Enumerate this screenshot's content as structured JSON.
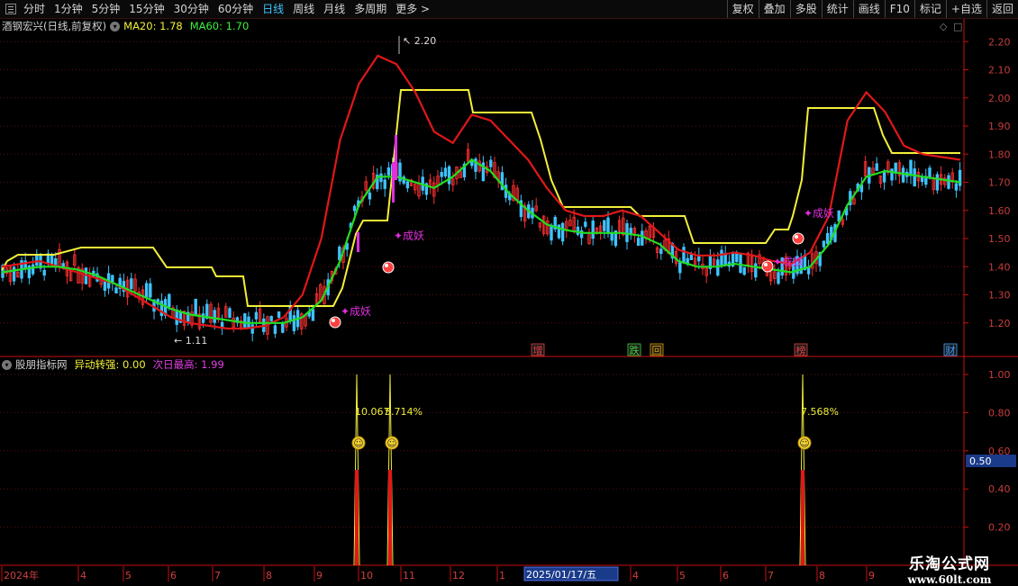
{
  "toolbar": {
    "periods": [
      "分时",
      "1分钟",
      "5分钟",
      "15分钟",
      "30分钟",
      "60分钟",
      "日线",
      "周线",
      "月线",
      "多周期",
      "更多 >"
    ],
    "active_period": "日线",
    "buttons": [
      "复权",
      "叠加",
      "多股",
      "统计",
      "画线",
      "F10",
      "标记",
      "+自选",
      "返回"
    ]
  },
  "main_chart": {
    "stock_label": "酒钢宏兴(日线,前复权)",
    "ma20_label": "MA20: 1.78",
    "ma60_label": "MA60: 1.70",
    "y_ticks": [
      "2.20",
      "2.10",
      "2.00",
      "1.90",
      "1.80",
      "1.70",
      "1.60",
      "1.50",
      "1.40",
      "1.30",
      "1.20"
    ],
    "high_label": "2.20",
    "low_label": "1.11",
    "signals": [
      "成妖",
      "成妖",
      "成妖",
      "成妖"
    ],
    "event_tags": [
      "增",
      "跌",
      "回",
      "榜",
      "财"
    ]
  },
  "indicator": {
    "name": "股朋指标网",
    "value1": "异动转强: 0.00",
    "value2": "次日最高: 1.99",
    "y_ticks": [
      "1.00",
      "0.80",
      "0.60",
      "0.40",
      "0.20"
    ],
    "current_value": "0.50",
    "pct_labels": [
      "10.067",
      "5.714%",
      "7.568%"
    ]
  },
  "time_axis": {
    "labels": [
      "2024年",
      "4",
      "5",
      "6",
      "7",
      "8",
      "9",
      "10",
      "11",
      "12",
      "1",
      "4",
      "5",
      "6",
      "7",
      "8",
      "9"
    ],
    "cursor_date": "2025/01/17/五"
  },
  "watermark": {
    "line1": "乐淘公式网",
    "line2": "www.60lt.com"
  },
  "chart_data": {
    "type": "line",
    "title": "酒钢宏兴(日线,前复权)",
    "ylim": [
      1.11,
      2.2
    ],
    "series": [
      {
        "name": "MA20",
        "values": [
          1.4,
          1.41,
          1.42,
          1.4,
          1.38,
          1.36,
          1.34,
          1.3,
          1.26,
          1.22,
          1.2,
          1.19,
          1.18,
          1.18,
          1.19,
          1.22,
          1.3,
          1.5,
          1.85,
          2.05,
          2.15,
          2.12,
          2.02,
          1.88,
          1.84,
          1.94,
          1.92,
          1.85,
          1.78,
          1.68,
          1.6,
          1.58,
          1.58,
          1.6,
          1.58,
          1.52,
          1.46,
          1.44,
          1.44,
          1.45,
          1.44,
          1.42,
          1.41,
          1.45,
          1.58,
          1.92,
          2.02,
          1.95,
          1.83,
          1.8,
          1.79,
          1.78
        ]
      },
      {
        "name": "MA60",
        "values": [
          1.38,
          1.39,
          1.4,
          1.4,
          1.39,
          1.37,
          1.34,
          1.31,
          1.28,
          1.25,
          1.23,
          1.22,
          1.21,
          1.2,
          1.2,
          1.2,
          1.22,
          1.28,
          1.42,
          1.62,
          1.72,
          1.72,
          1.7,
          1.68,
          1.72,
          1.78,
          1.74,
          1.66,
          1.6,
          1.55,
          1.53,
          1.52,
          1.52,
          1.52,
          1.51,
          1.48,
          1.42,
          1.4,
          1.4,
          1.41,
          1.4,
          1.39,
          1.38,
          1.4,
          1.48,
          1.62,
          1.72,
          1.74,
          1.73,
          1.72,
          1.71,
          1.7
        ]
      }
    ],
    "indicator_signals": [
      1.0,
      1.0,
      1.0
    ]
  }
}
